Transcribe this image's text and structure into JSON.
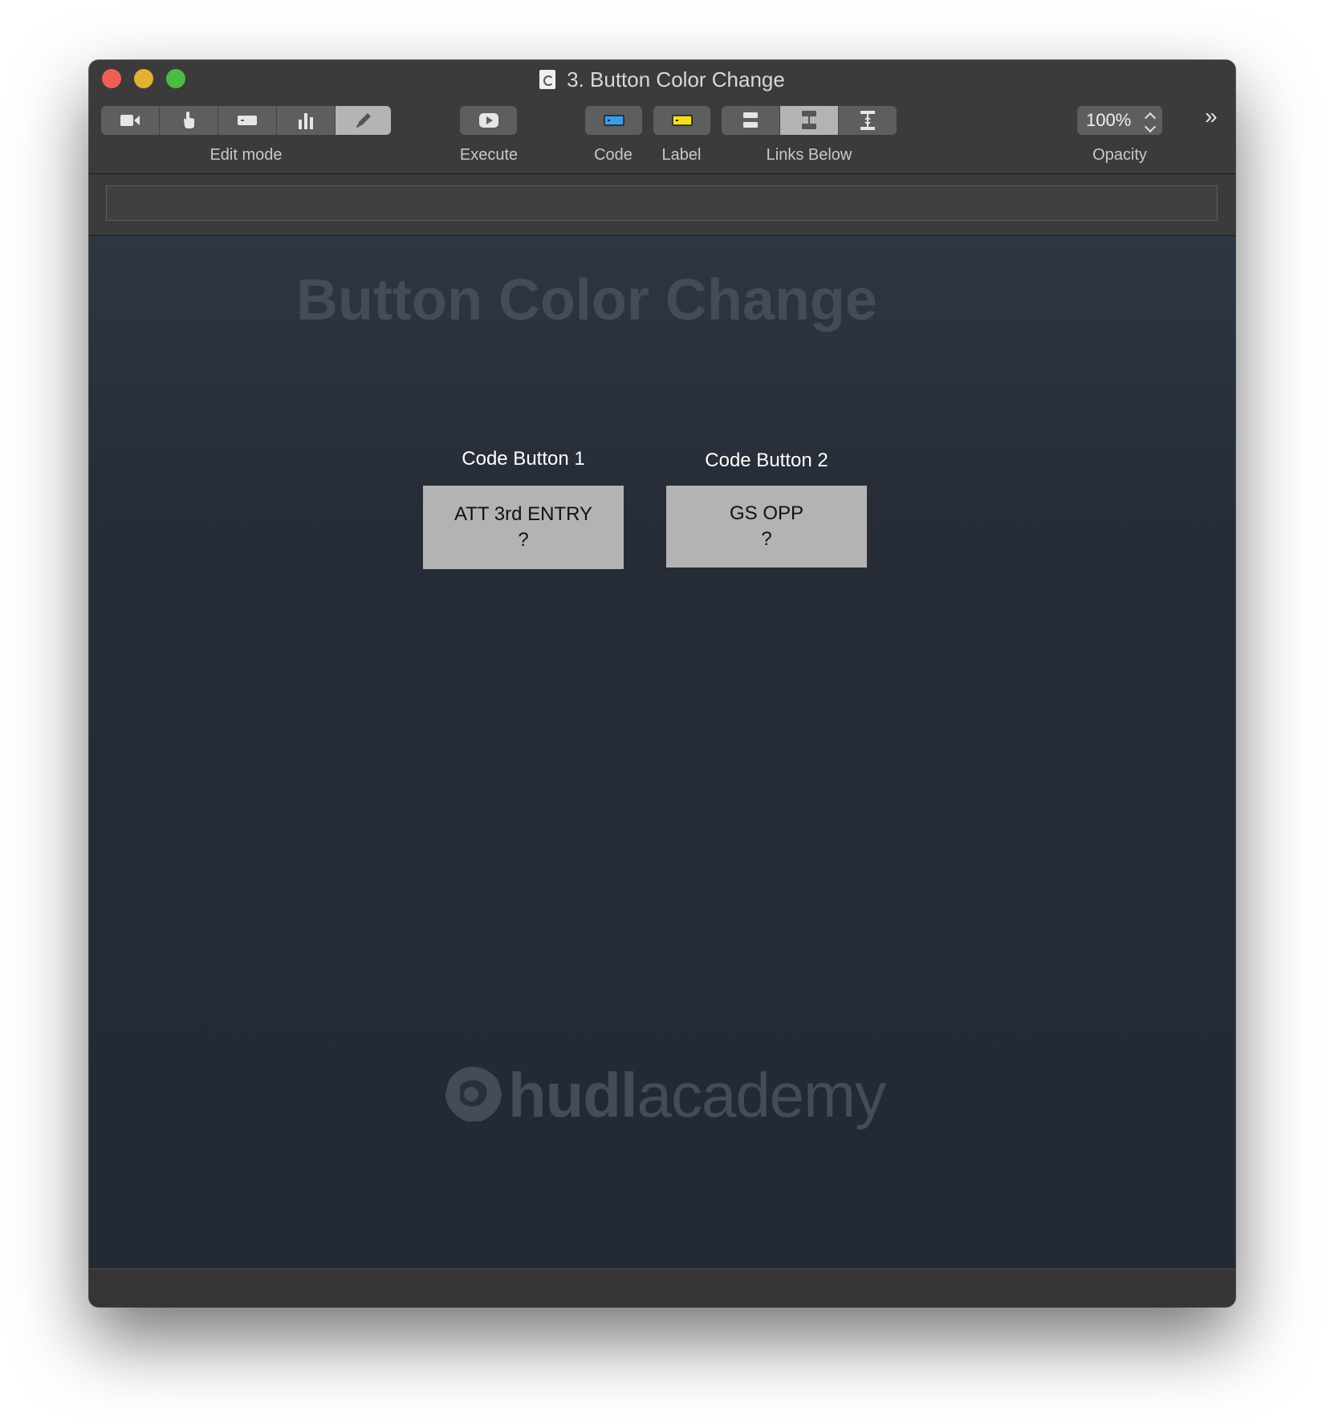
{
  "window": {
    "title": "3. Button Color Change"
  },
  "toolbar": {
    "edit_mode": {
      "label": "Edit mode",
      "segments": [
        {
          "icon": "video-camera-icon",
          "active": false
        },
        {
          "icon": "pointing-hand-icon",
          "active": false
        },
        {
          "icon": "button-shape-icon",
          "active": false
        },
        {
          "icon": "bar-chart-icon",
          "active": false
        },
        {
          "icon": "pencil-icon",
          "active": true
        }
      ]
    },
    "execute": {
      "label": "Execute",
      "icon": "play-icon"
    },
    "code": {
      "label": "Code",
      "icon": "code-button-icon",
      "color": "#3a9be8"
    },
    "label_btn": {
      "label": "Label",
      "icon": "label-button-icon",
      "color": "#f3e01c"
    },
    "links_below": {
      "label": "Links Below",
      "segments": [
        {
          "icon": "links-stacked-icon",
          "active": false
        },
        {
          "icon": "links-below-icon",
          "active": true
        },
        {
          "icon": "links-anchored-icon",
          "active": false
        }
      ]
    },
    "opacity": {
      "label": "Opacity",
      "value": "100%"
    },
    "overflow": "»"
  },
  "canvas": {
    "title": "Button Color Change",
    "buttons": [
      {
        "caption": "Code Button 1",
        "line1": "ATT 3rd ENTRY",
        "line2": "?"
      },
      {
        "caption": "Code Button 2",
        "line1": "GS OPP",
        "line2": "?"
      }
    ],
    "logo": {
      "bold": "hudl",
      "light": "academy"
    }
  },
  "colors": {
    "canvas_bg": "#262c36",
    "button_bg": "#b3b3b3",
    "watermark": "#454c57"
  }
}
